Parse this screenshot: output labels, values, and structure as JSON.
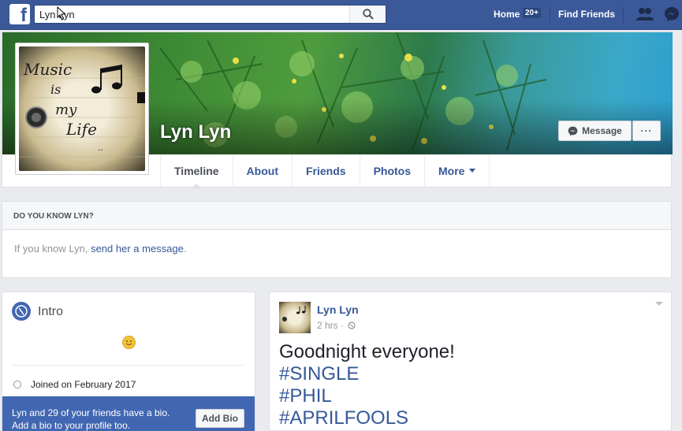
{
  "topbar": {
    "logo": "f",
    "search_value": "Lyn Lyn",
    "home_label": "Home",
    "home_badge": "20+",
    "find_friends_label": "Find Friends",
    "icons": [
      "search-icon",
      "friend-requests-icon",
      "messenger-icon"
    ]
  },
  "profile": {
    "name": "Lyn Lyn",
    "photo_text": [
      "Music",
      "is",
      "my",
      "Life"
    ],
    "message_label": "Message",
    "more_label": "···",
    "tabs": [
      {
        "label": "Timeline",
        "active": true
      },
      {
        "label": "About",
        "active": false
      },
      {
        "label": "Friends",
        "active": false
      },
      {
        "label": "Photos",
        "active": false
      },
      {
        "label": "More",
        "active": false
      }
    ]
  },
  "know_box": {
    "heading": "DO YOU KNOW LYN?",
    "prefix": "If you know Lyn, ",
    "link": "send her a message",
    "suffix": "."
  },
  "intro": {
    "title": "Intro",
    "joined": "Joined on February 2017",
    "bio_line1": "Lyn and 29 of your friends have a bio.",
    "bio_line2": "Add a bio to your profile too.",
    "add_bio_label": "Add Bio"
  },
  "post": {
    "author": "Lyn Lyn",
    "time": "2 hrs ·",
    "text": "Goodnight everyone!",
    "hashtags": [
      "#SINGLE",
      "#PHIL",
      "#APRILFOOLS"
    ]
  },
  "colors": {
    "brand": "#3b5998",
    "link": "#365899",
    "bio_blue": "#4267b2"
  }
}
